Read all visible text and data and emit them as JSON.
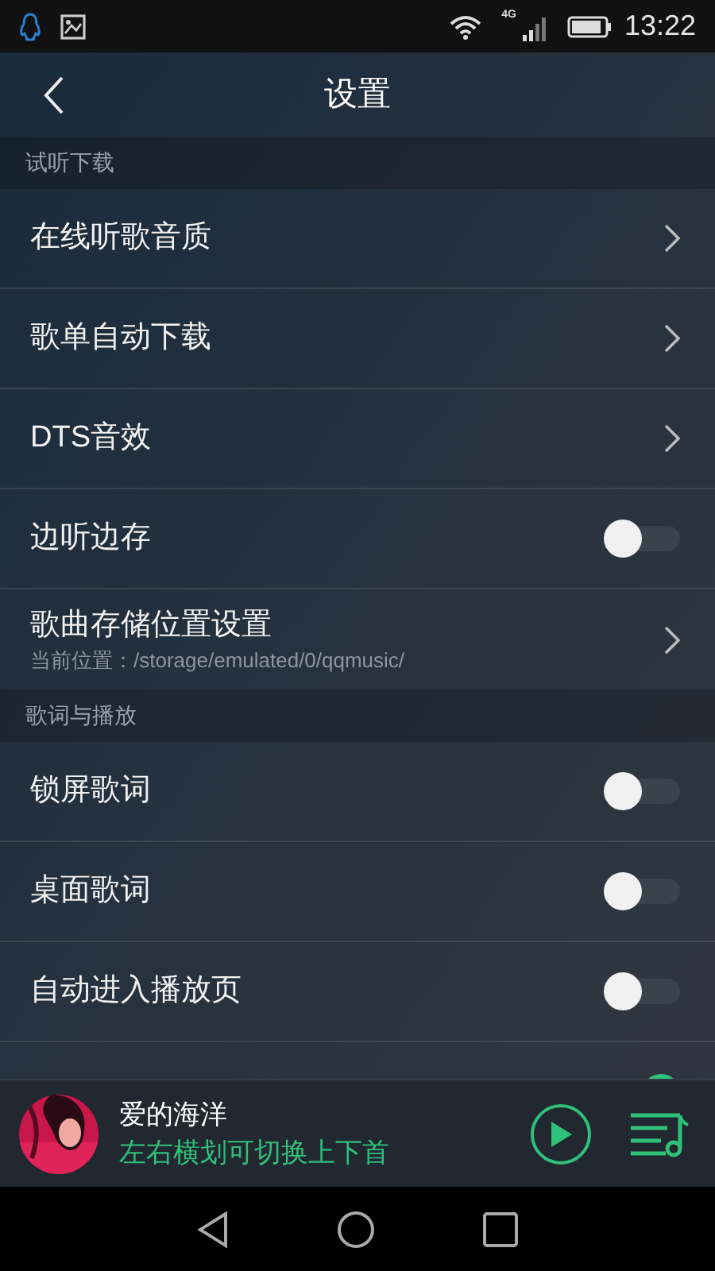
{
  "status_bar": {
    "network": "4G",
    "time": "13:22"
  },
  "header": {
    "title": "设置"
  },
  "sections": [
    {
      "title": "试听下载",
      "items": [
        {
          "kind": "link",
          "label": "在线听歌音质"
        },
        {
          "kind": "link",
          "label": "歌单自动下载"
        },
        {
          "kind": "link",
          "label": "DTS音效"
        },
        {
          "kind": "toggle",
          "label": "边听边存",
          "on": false
        },
        {
          "kind": "link",
          "label": "歌曲存储位置设置",
          "detail": "当前位置：/storage/emulated/0/qqmusic/"
        }
      ]
    },
    {
      "title": "歌词与播放",
      "items": [
        {
          "kind": "toggle",
          "label": "锁屏歌词",
          "on": false
        },
        {
          "kind": "toggle",
          "label": "桌面歌词",
          "on": false
        },
        {
          "kind": "toggle",
          "label": "自动进入播放页",
          "on": false
        },
        {
          "kind": "toggle",
          "on": true
        }
      ]
    }
  ],
  "player": {
    "song": "爱的海洋",
    "hint": "左右横划可切换上下首"
  }
}
